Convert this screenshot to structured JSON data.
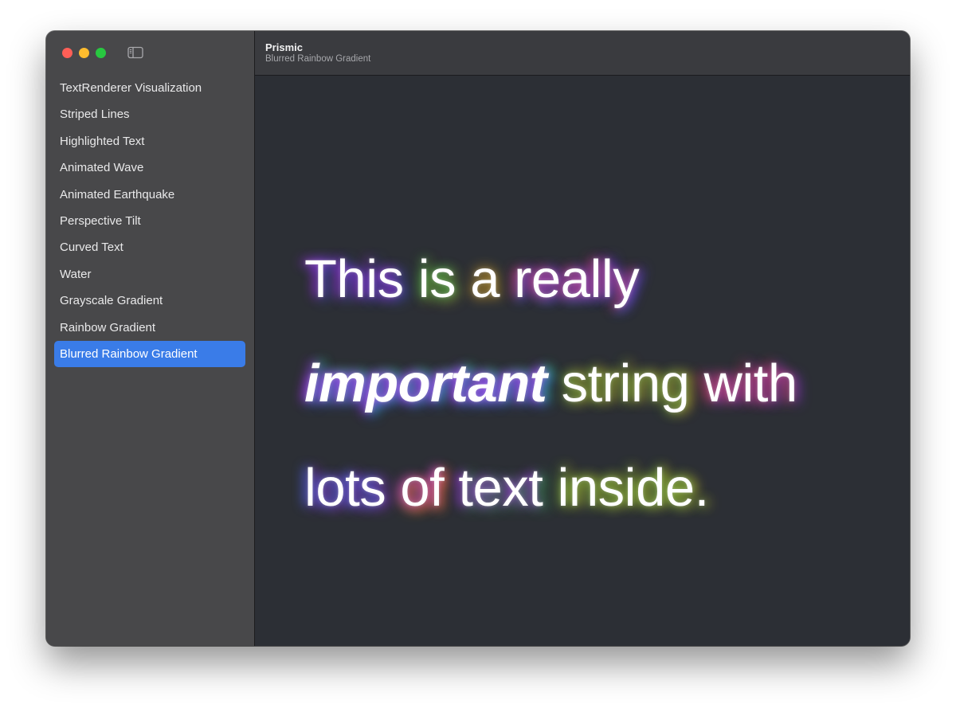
{
  "window": {
    "title": "Prismic",
    "subtitle": "Blurred Rainbow Gradient"
  },
  "sidebar": {
    "items": [
      {
        "label": "TextRenderer Visualization"
      },
      {
        "label": "Striped Lines"
      },
      {
        "label": "Highlighted Text"
      },
      {
        "label": "Animated Wave"
      },
      {
        "label": "Animated Earthquake"
      },
      {
        "label": "Perspective Tilt"
      },
      {
        "label": "Curved Text"
      },
      {
        "label": "Water"
      },
      {
        "label": "Grayscale Gradient"
      },
      {
        "label": "Rainbow Gradient"
      },
      {
        "label": "Blurred Rainbow Gradient",
        "selected": true
      }
    ],
    "toggle_icon": "sidebar-toggle-icon"
  },
  "demo": {
    "line1": {
      "w1": "This",
      "w2": "is",
      "w3": "a",
      "w4": "really"
    },
    "line2": {
      "w5": "important",
      "w6": "string",
      "w7": "with"
    },
    "line3": {
      "w8": "lots",
      "w9": "of",
      "w10": "text",
      "w11": "inside."
    }
  },
  "colors": {
    "accent": "#3a7ce8",
    "sidebar_bg": "#48484a",
    "content_bg": "#2c2f35",
    "close": "#ff5f57",
    "minimize": "#febc2e",
    "zoom": "#28c840"
  }
}
